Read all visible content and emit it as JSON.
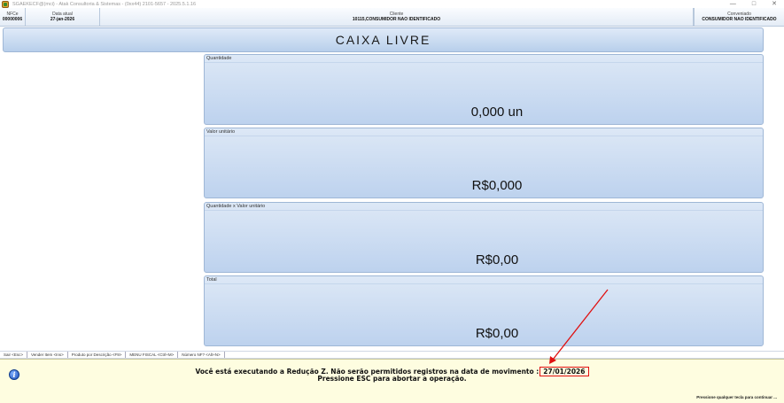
{
  "window": {
    "title": "SGAEKECF@(mci) - Atak Consultoria & Sistemas - (0xx44) 2101-5657 - 2025.5.1.16",
    "minimize_glyph": "—",
    "maximize_glyph": "□",
    "close_glyph": "✕"
  },
  "header": {
    "nfce_label": "NFCe",
    "nfce_value": "00000006",
    "date_label": "Data atual",
    "date_value": "27-jan-2026",
    "client_label": "Cliente",
    "client_value": "10115,CONSUMIDOR NAO IDENTIFICADO",
    "conv_label": "Conveniado",
    "conv_value": "CONSUMIDOR NAO IDENTIFICADO"
  },
  "banner": {
    "status": "CAIXA LIVRE"
  },
  "panels": {
    "quantidade": {
      "label": "Quantidade",
      "value": "0,000 un"
    },
    "valor_unitario": {
      "label": "Valor unitário",
      "value": "R$0,000"
    },
    "qtd_x_valor": {
      "label": "Quantidade x Valor unitário",
      "value": "R$0,00"
    },
    "total": {
      "label": "Total",
      "value": "R$0,00"
    }
  },
  "shortcuts": [
    "Sair <Esc>",
    "Vender Item <Ins>",
    "Produto por Descrição <F9>",
    "MENU FISCAL <Ctrl+M>",
    "Número NF? <Alt+N>"
  ],
  "message": {
    "line1_prefix": "Você está executando a Redução Z. Não serão permitidos registros na data de movimento :",
    "line1_date": "27/01/2026",
    "line2": "Pressione ESC para abortar a operação.",
    "continue": "Pressione qualquer tecla para continuar ..."
  },
  "colors": {
    "annotation": "#e01010",
    "panel_top": "#dde8f6",
    "panel_bottom": "#bdd2ee",
    "message_bg": "#fefde0"
  }
}
